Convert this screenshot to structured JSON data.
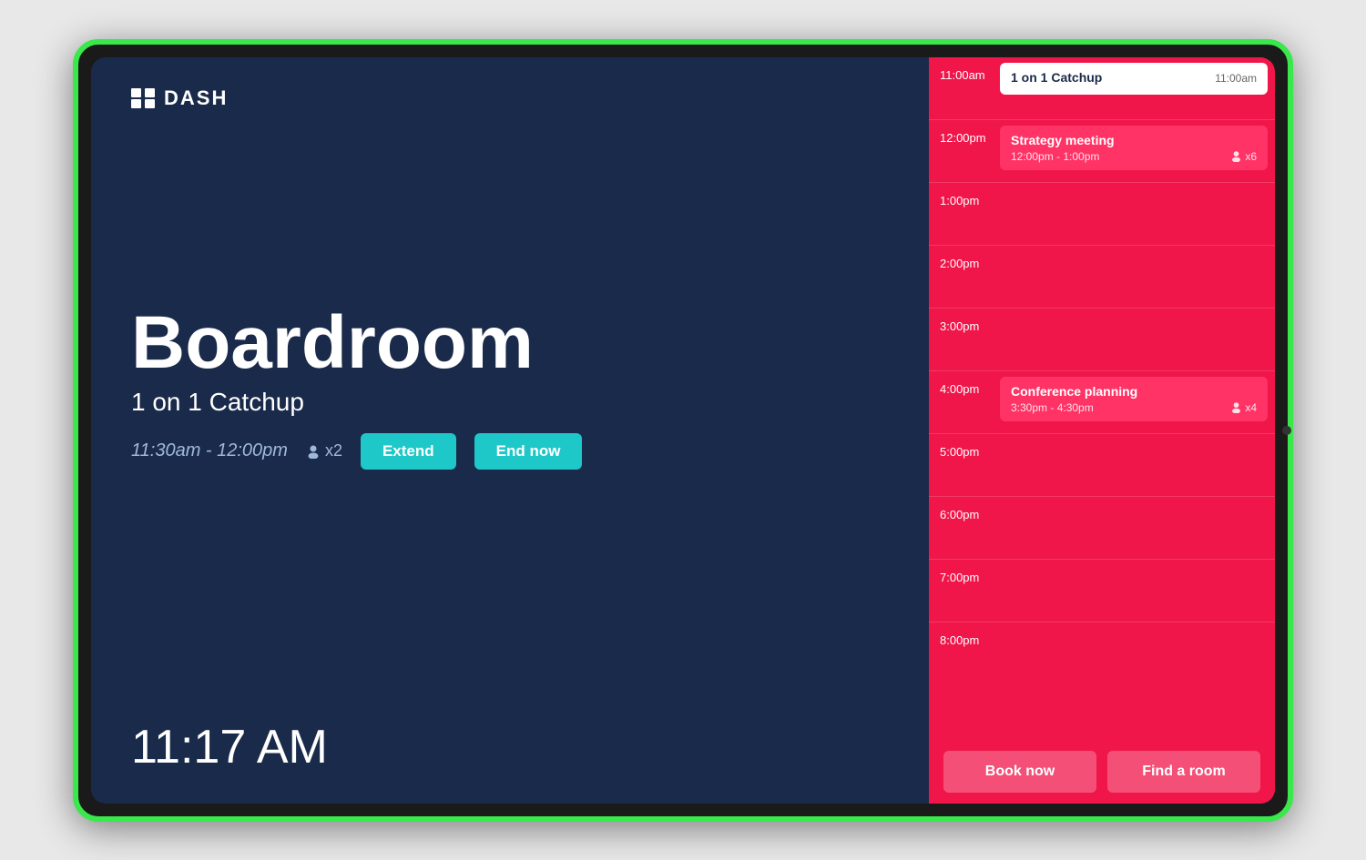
{
  "logo": {
    "icon": "✦",
    "text": "DASH"
  },
  "left": {
    "room_name": "Boardroom",
    "meeting_title": "1 on 1 Catchup",
    "meeting_time": "11:30am - 12:00pm",
    "attendees_icon": "👤",
    "attendees_count": "x2",
    "btn_extend": "Extend",
    "btn_end_now": "End now",
    "current_time": "11:17 AM"
  },
  "schedule": {
    "slots": [
      {
        "time": "11:00am",
        "event": {
          "name": "1 on 1 Catchup",
          "time_left": "11:00am",
          "style": "first"
        }
      },
      {
        "time": "12:00pm",
        "event": {
          "name": "Strategy meeting",
          "time_range": "12:00pm - 1:00pm",
          "attendees": "x6",
          "style": "dark"
        }
      },
      {
        "time": "1:00pm",
        "event": null
      },
      {
        "time": "2:00pm",
        "event": null
      },
      {
        "time": "3:00pm",
        "event": null
      },
      {
        "time": "4:00pm",
        "event": {
          "name": "Conference planning",
          "time_range": "3:30pm - 4:30pm",
          "attendees": "x4",
          "style": "dark"
        }
      },
      {
        "time": "5:00pm",
        "event": null
      },
      {
        "time": "6:00pm",
        "event": null
      },
      {
        "time": "7:00pm",
        "event": null
      },
      {
        "time": "8:00pm",
        "event": null
      }
    ]
  },
  "bottom_buttons": {
    "book_now": "Book now",
    "find_room": "Find a room"
  }
}
